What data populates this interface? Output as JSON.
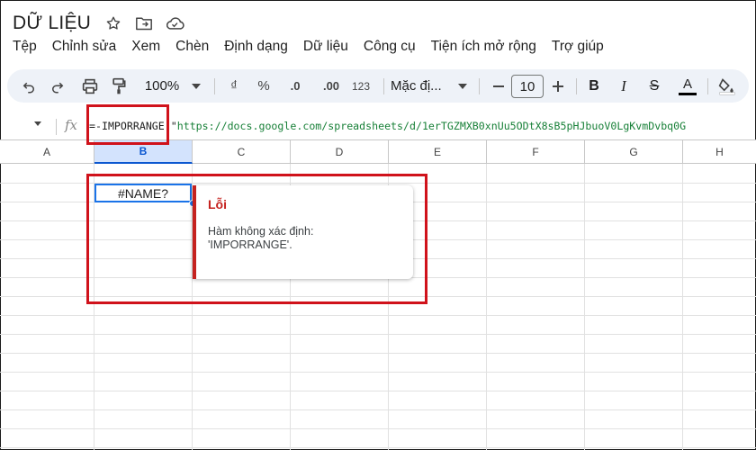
{
  "doc": {
    "title": "DỮ LIỆU"
  },
  "menu": [
    "Tệp",
    "Chỉnh sửa",
    "Xem",
    "Chèn",
    "Định dạng",
    "Dữ liệu",
    "Công cụ",
    "Tiện ích mở rộng",
    "Trợ giúp"
  ],
  "toolbar": {
    "zoom": "100%",
    "currency": "₫",
    "percent": "%",
    "decrease_decimal": ".0",
    "increase_decimal": ".00",
    "number_format": "123",
    "font": "Mặc đị...",
    "font_size": "10",
    "bold": "B",
    "italic": "I",
    "strikethrough": "S",
    "text_color": "A"
  },
  "formula_bar": {
    "fx_label": "fx",
    "formula_prefix": "=-IMPORRANGE(\"",
    "formula_string": "https://docs.google.com/spreadsheets/d/1erTGZMXB0xnUu5ODtX8sB5pHJbuoV0LgKvmDvbq0G"
  },
  "columns": [
    "A",
    "B",
    "C",
    "D",
    "E",
    "F",
    "G",
    "H"
  ],
  "selected_column": "B",
  "active_cell": {
    "value": "#NAME?"
  },
  "error_popup": {
    "title": "Lỗi",
    "message": "Hàm không xác định: 'IMPORRANGE'."
  },
  "colors": {
    "accent": "#1a73e8",
    "error": "#c5221f",
    "highlight": "#d0121b",
    "toolbar_bg": "#eef2f8",
    "formula_string": "#188038"
  }
}
